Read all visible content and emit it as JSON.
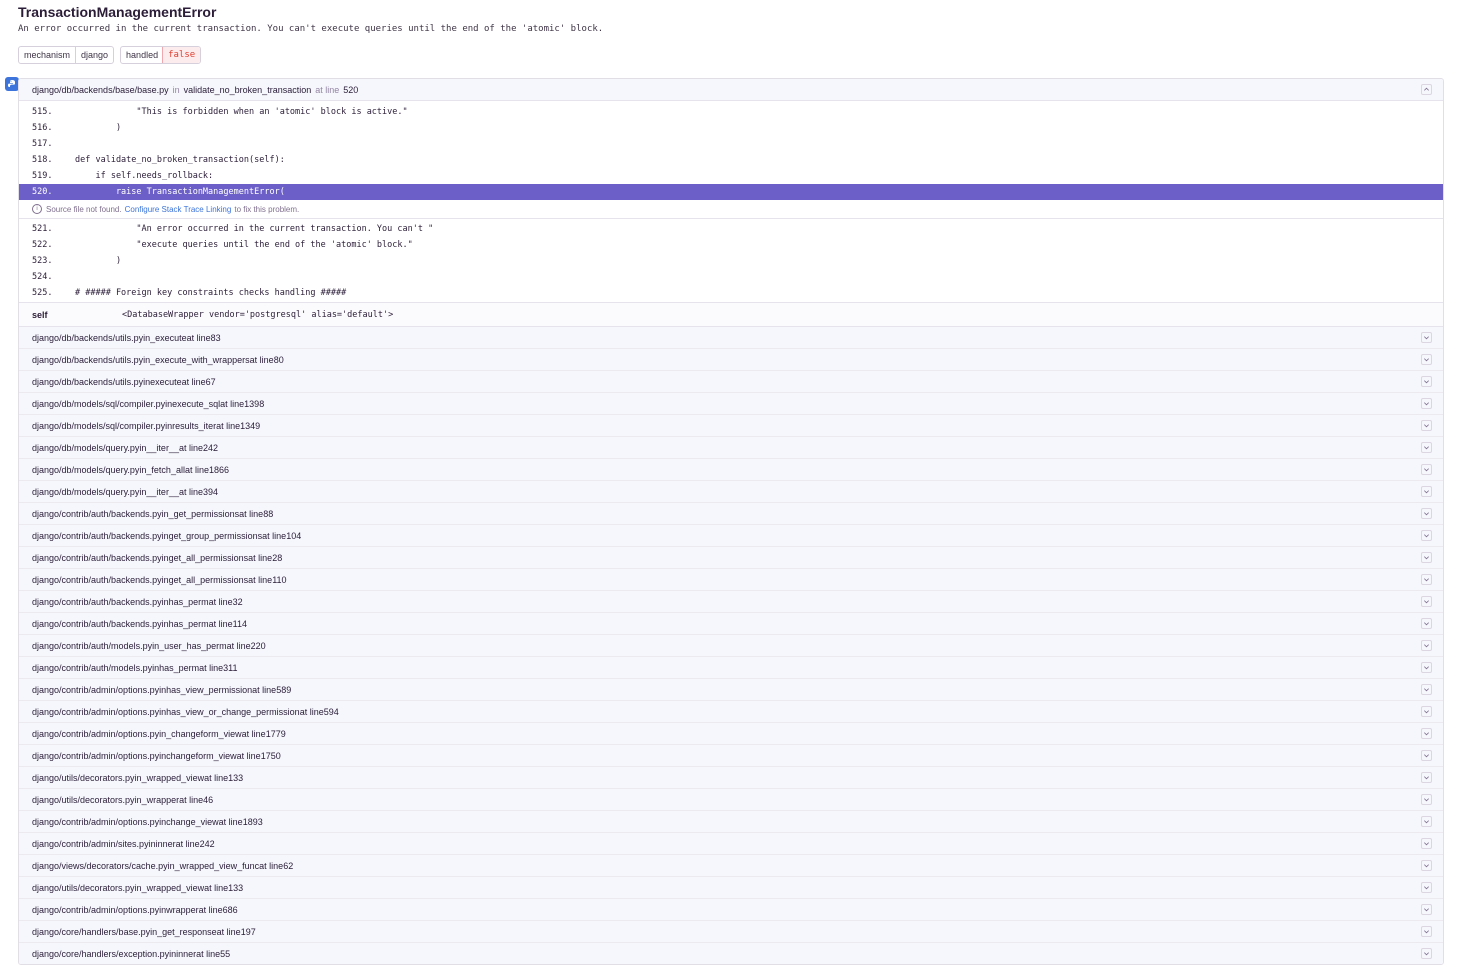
{
  "error": {
    "title": "TransactionManagementError",
    "message": "An error occurred in the current transaction. You can't execute queries until the end of the 'atomic' block."
  },
  "tags": [
    {
      "key": "mechanism",
      "value": "django",
      "bad": false
    },
    {
      "key": "handled",
      "value": "false",
      "bad": true
    }
  ],
  "top_frame": {
    "file": "django/db/backends/base/base.py",
    "in_label": "in",
    "function": "validate_no_broken_transaction",
    "at_line_label": "at line",
    "line": "520",
    "context_before": [
      {
        "ln": "515.",
        "code": "            \"This is forbidden when an 'atomic' block is active.\""
      },
      {
        "ln": "516.",
        "code": "        )"
      },
      {
        "ln": "517.",
        "code": ""
      },
      {
        "ln": "518.",
        "code": "def validate_no_broken_transaction(self):"
      },
      {
        "ln": "519.",
        "code": "    if self.needs_rollback:"
      }
    ],
    "active_line": {
      "ln": "520.",
      "code": "        raise TransactionManagementError("
    },
    "notice": {
      "prefix": "Source file not found.",
      "link": "Configure Stack Trace Linking",
      "suffix": "to fix this problem."
    },
    "context_after": [
      {
        "ln": "521.",
        "code": "            \"An error occurred in the current transaction. You can't \""
      },
      {
        "ln": "522.",
        "code": "            \"execute queries until the end of the 'atomic' block.\""
      },
      {
        "ln": "523.",
        "code": "        )"
      },
      {
        "ln": "524.",
        "code": ""
      },
      {
        "ln": "525.",
        "code": "# ##### Foreign key constraints checks handling #####"
      }
    ],
    "vars": [
      {
        "name": "self",
        "value": "<DatabaseWrapper vendor='postgresql' alias='default'>"
      }
    ]
  },
  "frames": [
    {
      "file": "django/db/backends/utils.py",
      "function": "_execute",
      "line": "83"
    },
    {
      "file": "django/db/backends/utils.py",
      "function": "_execute_with_wrappers",
      "line": "80"
    },
    {
      "file": "django/db/backends/utils.py",
      "function": "execute",
      "line": "67"
    },
    {
      "file": "django/db/models/sql/compiler.py",
      "function": "execute_sql",
      "line": "1398"
    },
    {
      "file": "django/db/models/sql/compiler.py",
      "function": "results_iter",
      "line": "1349"
    },
    {
      "file": "django/db/models/query.py",
      "function": "__iter__",
      "line": "242"
    },
    {
      "file": "django/db/models/query.py",
      "function": "_fetch_all",
      "line": "1866"
    },
    {
      "file": "django/db/models/query.py",
      "function": "__iter__",
      "line": "394"
    },
    {
      "file": "django/contrib/auth/backends.py",
      "function": "_get_permissions",
      "line": "88"
    },
    {
      "file": "django/contrib/auth/backends.py",
      "function": "get_group_permissions",
      "line": "104"
    },
    {
      "file": "django/contrib/auth/backends.py",
      "function": "get_all_permissions",
      "line": "28"
    },
    {
      "file": "django/contrib/auth/backends.py",
      "function": "get_all_permissions",
      "line": "110"
    },
    {
      "file": "django/contrib/auth/backends.py",
      "function": "has_perm",
      "line": "32"
    },
    {
      "file": "django/contrib/auth/backends.py",
      "function": "has_perm",
      "line": "114"
    },
    {
      "file": "django/contrib/auth/models.py",
      "function": "_user_has_perm",
      "line": "220"
    },
    {
      "file": "django/contrib/auth/models.py",
      "function": "has_perm",
      "line": "311"
    },
    {
      "file": "django/contrib/admin/options.py",
      "function": "has_view_permission",
      "line": "589"
    },
    {
      "file": "django/contrib/admin/options.py",
      "function": "has_view_or_change_permission",
      "line": "594"
    },
    {
      "file": "django/contrib/admin/options.py",
      "function": "_changeform_view",
      "line": "1779"
    },
    {
      "file": "django/contrib/admin/options.py",
      "function": "changeform_view",
      "line": "1750"
    },
    {
      "file": "django/utils/decorators.py",
      "function": "_wrapped_view",
      "line": "133"
    },
    {
      "file": "django/utils/decorators.py",
      "function": "_wrapper",
      "line": "46"
    },
    {
      "file": "django/contrib/admin/options.py",
      "function": "change_view",
      "line": "1893"
    },
    {
      "file": "django/contrib/admin/sites.py",
      "function": "inner",
      "line": "242"
    },
    {
      "file": "django/views/decorators/cache.py",
      "function": "_wrapped_view_func",
      "line": "62"
    },
    {
      "file": "django/utils/decorators.py",
      "function": "_wrapped_view",
      "line": "133"
    },
    {
      "file": "django/contrib/admin/options.py",
      "function": "wrapper",
      "line": "686"
    },
    {
      "file": "django/core/handlers/base.py",
      "function": "_get_response",
      "line": "197"
    },
    {
      "file": "django/core/handlers/exception.py",
      "function": "inner",
      "line": "55"
    }
  ],
  "colors": {
    "accent": "#6c5fc7",
    "link": "#3d74db",
    "error": "#e03e2f",
    "badge": "#3d74db"
  }
}
